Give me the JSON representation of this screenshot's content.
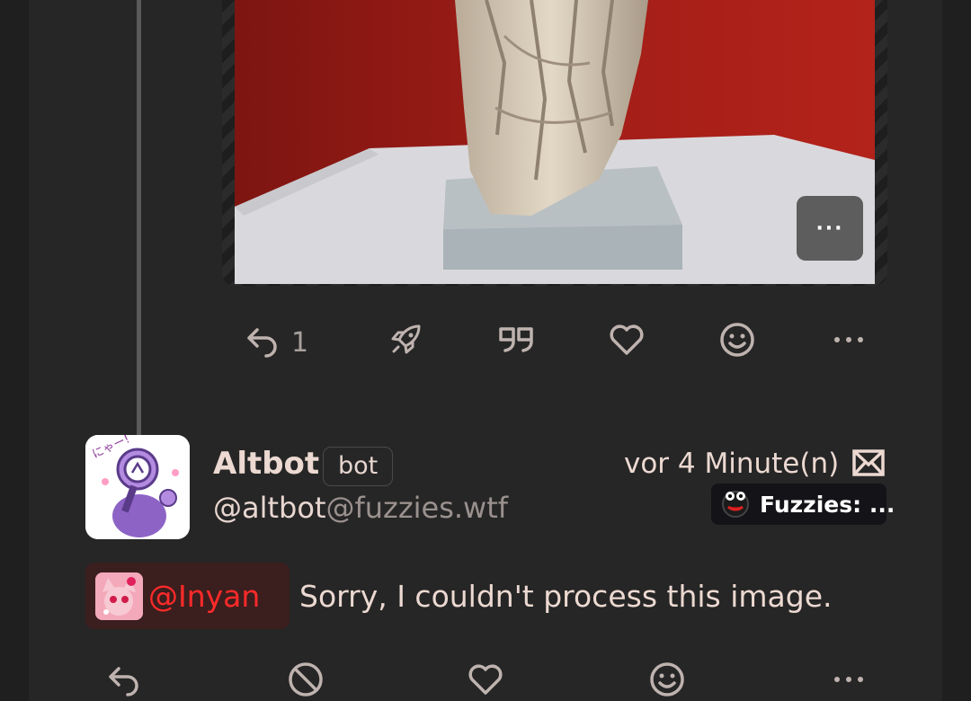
{
  "media": {
    "more_label": "···"
  },
  "post1_actions": {
    "reply_count": "1"
  },
  "post2": {
    "display_name": "Altbot",
    "badge": "bot",
    "handle_user": "@altbot",
    "handle_host": "@fuzzies.wtf",
    "timestamp": "vor 4 Minute(n)",
    "instance_label": "Fuzzies: ...",
    "mention": "@Inyan",
    "text": "Sorry, I couldn't process this image.",
    "avatar_text": "にゃー!"
  },
  "colors": {
    "background": "#1f1f1f",
    "panel": "#262626",
    "mention_text": "#ff2a2a",
    "mention_bg": "#3b1e1e"
  },
  "icons": {
    "post1": [
      "reply-icon",
      "boost-icon",
      "quote-icon",
      "like-icon",
      "emoji-reaction-icon",
      "more-icon"
    ],
    "post2": [
      "reply-icon",
      "no-boost-icon",
      "like-icon",
      "emoji-reaction-icon",
      "more-icon"
    ]
  }
}
